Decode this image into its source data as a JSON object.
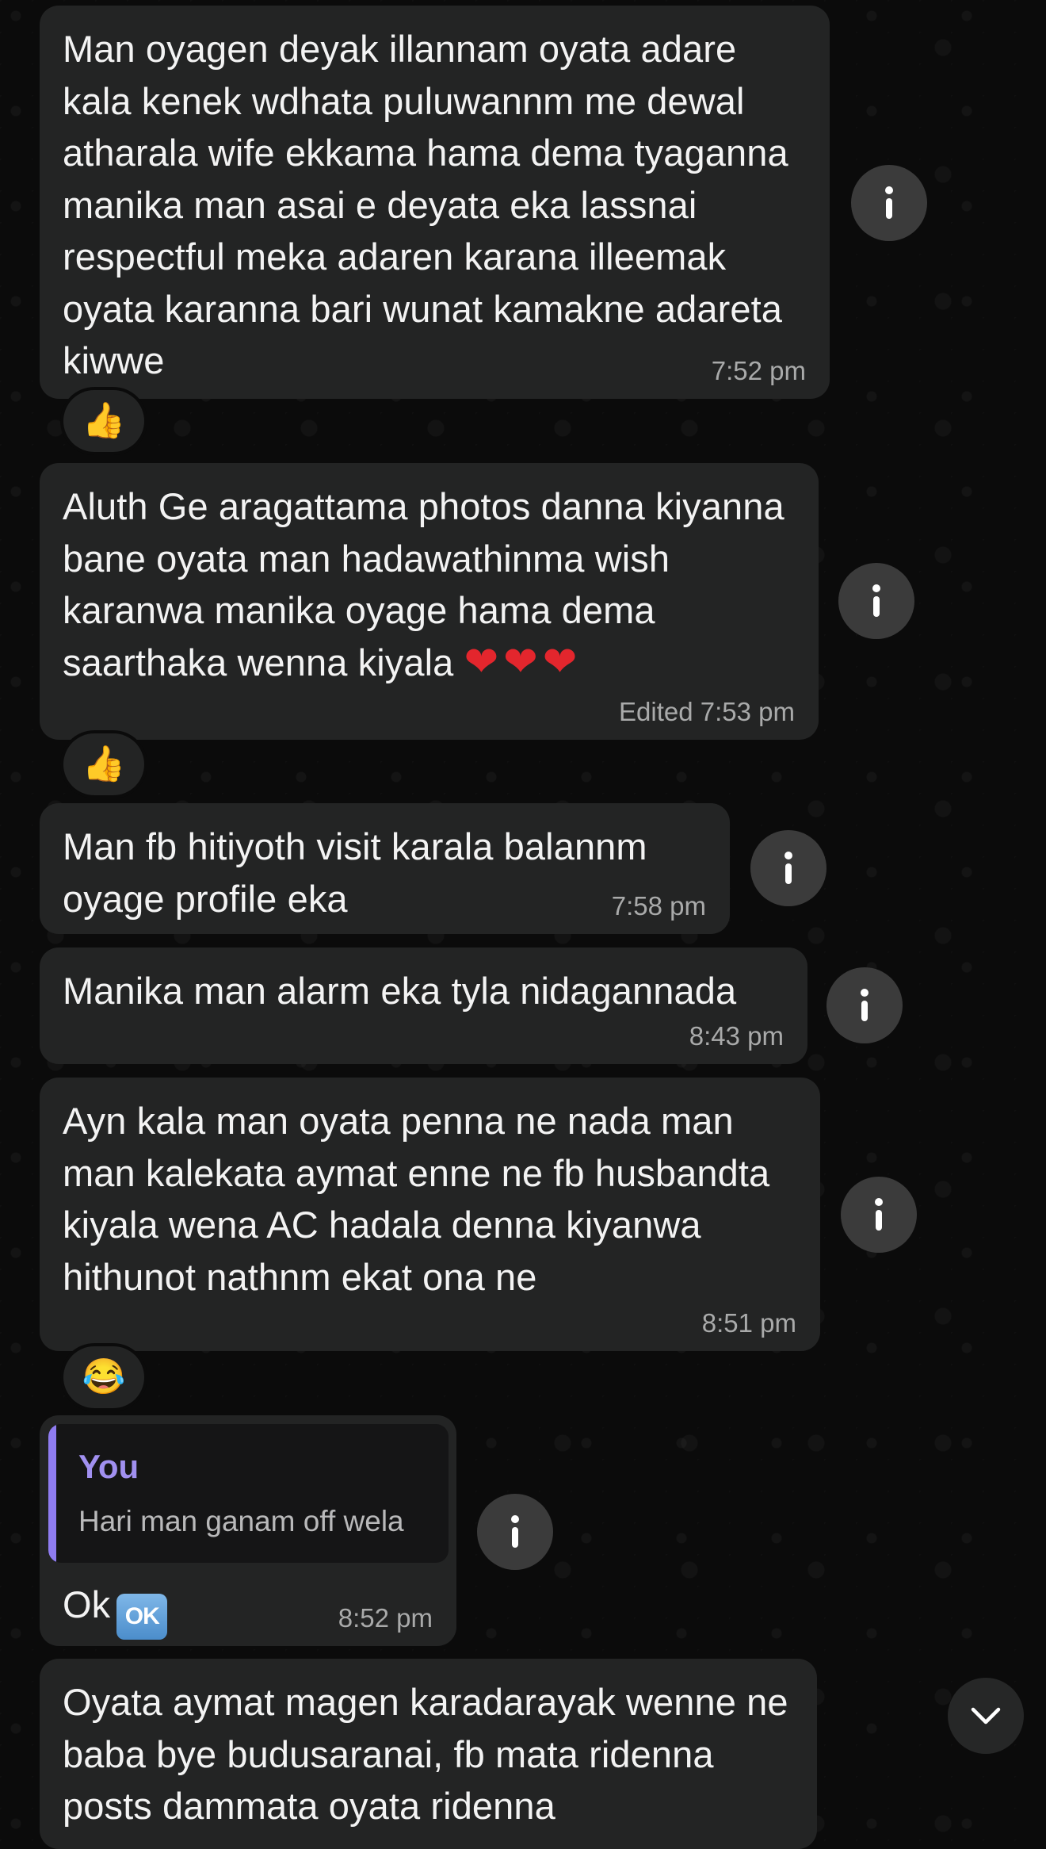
{
  "messages": [
    {
      "text": "Man oyagen deyak illannam oyata adare kala kenek wdhata puluwannm me dewal atharala wife ekkama hama dema tyaganna manika man asai e deyata eka lassnai respectful meka adaren karana illeemak oyata karanna bari wunat kamakne adareta kiwwe",
      "time": "7:52 pm",
      "reaction": "👍"
    },
    {
      "text": "Aluth Ge aragattama photos danna kiyanna bane oyata man hadawathinma wish karanwa manika oyage hama dema saarthaka wenna kiyala",
      "hearts": "❤❤❤",
      "time": "Edited 7:53 pm",
      "reaction": "👍"
    },
    {
      "text": "Man fb hitiyoth visit karala balannm oyage profile eka",
      "time": "7:58 pm"
    },
    {
      "text": "Manika man alarm eka tyla nidagannada",
      "time": "8:43 pm"
    },
    {
      "text": "Ayn kala man oyata penna ne nada man man kalekata aymat enne ne fb husbandta kiyala wena AC hadala denna kiyanwa hithunot nathnm ekat ona ne",
      "time": "8:51 pm",
      "reaction": "😂"
    },
    {
      "reply_author": "You",
      "reply_text": "Hari man ganam off wela",
      "text": "Ok",
      "badge": "OK",
      "time": "8:52 pm"
    },
    {
      "text": "Oyata aymat magen karadarayak wenne ne baba bye budusaranai, fb mata ridenna posts dammata oyata ridenna"
    }
  ],
  "icons": {
    "info": "info-icon",
    "scroll_down": "chevron-down-icon"
  },
  "colors": {
    "background": "#0b0b0b",
    "bubble": "#232424",
    "reply_accent": "#8f7cf0",
    "timestamp": "#a9aaaa"
  }
}
